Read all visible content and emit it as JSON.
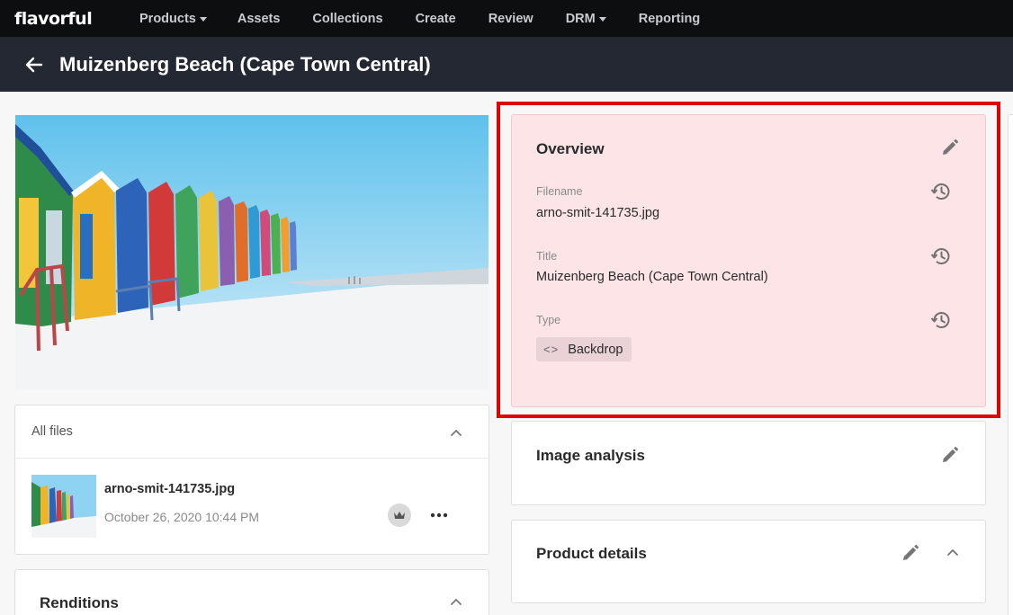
{
  "brand": {
    "logo": "flavorful"
  },
  "nav": [
    {
      "label": "Products",
      "dropdown": true
    },
    {
      "label": "Assets",
      "dropdown": false
    },
    {
      "label": "Collections",
      "dropdown": false
    },
    {
      "label": "Create",
      "dropdown": false
    },
    {
      "label": "Review",
      "dropdown": false
    },
    {
      "label": "DRM",
      "dropdown": true
    },
    {
      "label": "Reporting",
      "dropdown": false
    }
  ],
  "header": {
    "title": "Muizenberg Beach (Cape Town Central)",
    "back_icon": "arrow-left-icon"
  },
  "files": {
    "header": "All files",
    "items": [
      {
        "name": "arno-smit-141735.jpg",
        "date": "October 26, 2020 10:44 PM"
      }
    ]
  },
  "renditions": {
    "title": "Renditions"
  },
  "overview": {
    "title": "Overview",
    "fields": [
      {
        "label": "Filename",
        "value": "arno-smit-141735.jpg"
      },
      {
        "label": "Title",
        "value": "Muizenberg Beach (Cape Town Central)"
      },
      {
        "label": "Type",
        "value": "Backdrop"
      }
    ],
    "type_chip_icon": "<>"
  },
  "image_analysis": {
    "title": "Image analysis"
  },
  "product_details": {
    "title": "Product details"
  },
  "colors": {
    "topnav_bg": "#0d0e10",
    "titlebar_bg": "#232833",
    "overview_bg": "#fde4e7",
    "highlight_border": "#e10000"
  }
}
